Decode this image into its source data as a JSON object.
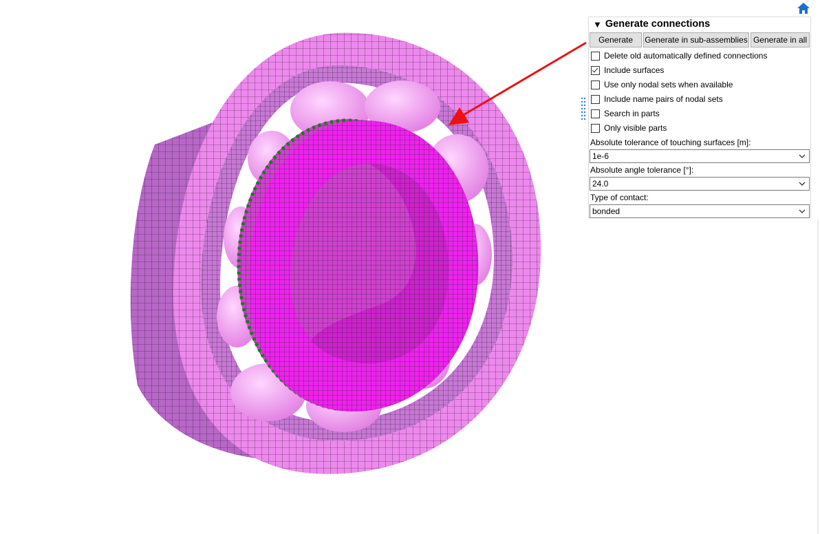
{
  "panel": {
    "title": "Generate connections",
    "collapse_glyph": "▼",
    "buttons": {
      "generate": "Generate",
      "generate_sub": "Generate in sub-assemblies",
      "generate_all": "Generate in all"
    },
    "options": [
      {
        "label": "Delete old automatically defined connections",
        "checked": false
      },
      {
        "label": "Include surfaces",
        "checked": true
      },
      {
        "label": "Use only nodal sets when available",
        "checked": false
      },
      {
        "label": "Include name pairs of nodal sets",
        "checked": false
      },
      {
        "label": "Search in parts",
        "checked": false
      },
      {
        "label": "Only visible parts",
        "checked": false
      }
    ],
    "tolerance_label": "Absolute tolerance of touching surfaces [m]:",
    "tolerance_value": "1e-6",
    "angle_label": "Absolute angle tolerance [°]:",
    "angle_value": "24.0",
    "contact_label": "Type of contact:",
    "contact_value": "bonded"
  },
  "icons": {
    "home": "home-icon",
    "chevron": "chevron-down-icon",
    "arrow": "red-arrow-annotation"
  },
  "colors": {
    "outer_ring": "#ee88ee",
    "outer_ring_side": "#b866c8",
    "inner_ring": "#ee22ee",
    "inner_ring_bore": "#cc22cc",
    "balls": "#ffaaff",
    "contact_nodes": "#1a7a1a",
    "arrow": "#ee1111",
    "home": "#1a6fd0"
  }
}
